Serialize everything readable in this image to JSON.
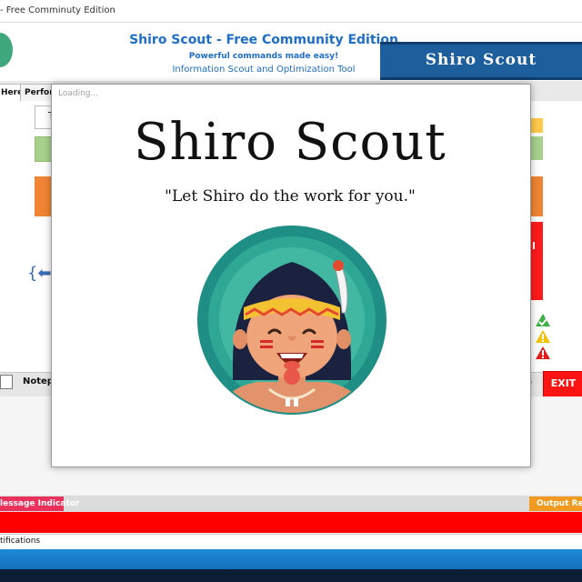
{
  "window": {
    "title": "- Free Comminuty Edition"
  },
  "header": {
    "title": "Shiro Scout - Free Community Edition",
    "subtitle": "Powerful commands made easy!",
    "tagline": "Information Scout and Optimization Tool",
    "banner": "Shiro Scout"
  },
  "tabs": [
    {
      "label": "Here"
    },
    {
      "label": "Perform"
    }
  ],
  "main": {
    "left_box_text": "T"
  },
  "bottom": {
    "notepad_label": "Notepa",
    "s_label": "s",
    "exit_label": "EXIT"
  },
  "status": {
    "message_indicator": "lessage Indicator",
    "output_results": "Output Resu",
    "notifications": "tifications"
  },
  "splash": {
    "loading": "Loading...",
    "title": "Shiro Scout",
    "quote": "\"Let Shiro do the work for you.\""
  },
  "colors": {
    "brand_blue": "#1e6ec8",
    "banner_blue": "#1d5e9c",
    "exit_red": "#ff1414",
    "teal": "#2a9a8a"
  },
  "icons": [
    "app-logo-icon",
    "notepad-icon",
    "check-icon",
    "warning-icon",
    "error-icon",
    "arrow-left-icon",
    "feather-icon"
  ]
}
